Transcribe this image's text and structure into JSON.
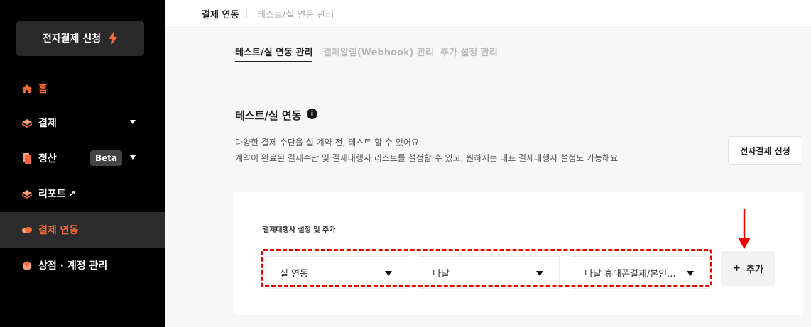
{
  "sidebar": {
    "apply_button": "전자결제 신청",
    "items": [
      {
        "label": "홈"
      },
      {
        "label": "결제"
      },
      {
        "label": "정산",
        "badge": "Beta"
      },
      {
        "label": "리포트",
        "ext_icon": "↗"
      },
      {
        "label": "결제 연동"
      },
      {
        "label": "상점 · 계정 관리"
      }
    ]
  },
  "breadcrumb": {
    "first": "결제 연동",
    "second": "테스트/실 연동 관리"
  },
  "tabs": [
    {
      "label": "테스트/실 연동 관리"
    },
    {
      "label": "결제알림(Webhook) 관리"
    },
    {
      "label": "추가 설정 관리"
    }
  ],
  "section": {
    "title": "테스트/실 연동",
    "info_icon": "i",
    "desc1": "다양한 결제 수단을 실 계약 전, 테스트 할 수 있어요",
    "desc2": "계약이 완료된 결제수단 및 결제대행사 리스트를 설정할 수 있고, 원하시는 대표 결제대행사 설정도 가능해요",
    "apply_button": "전자결제 신청"
  },
  "pg_setup": {
    "label": "결제대행사 설정 및 추가",
    "selects": [
      {
        "value": "실 연동"
      },
      {
        "value": "다날"
      },
      {
        "value": "다날 휴대폰결제/본인..."
      }
    ],
    "add_button": "추가",
    "add_icon": "+"
  },
  "colors": {
    "accent": "#f26a39",
    "highlight": "#e00000"
  }
}
